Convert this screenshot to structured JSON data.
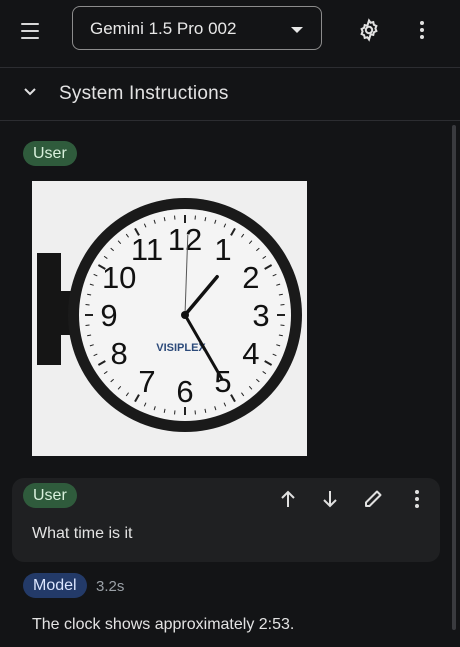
{
  "model_selector": {
    "label": "Gemini 1.5 Pro 002"
  },
  "system_instructions": {
    "label": "System Instructions"
  },
  "turns": [
    {
      "role": "User",
      "image": {
        "brand": "VISIPLEX",
        "dial_numbers": [
          "12",
          "1",
          "2",
          "3",
          "4",
          "5",
          "6",
          "7",
          "8",
          "9",
          "10",
          "11"
        ]
      }
    },
    {
      "role": "User",
      "text": "What time is it"
    },
    {
      "role": "Model",
      "time": "3.2s",
      "text": "The clock shows approximately 2:53."
    }
  ],
  "colors": {
    "user_chip": "#2f5b3c",
    "model_chip": "#233a68",
    "background": "#131416"
  }
}
